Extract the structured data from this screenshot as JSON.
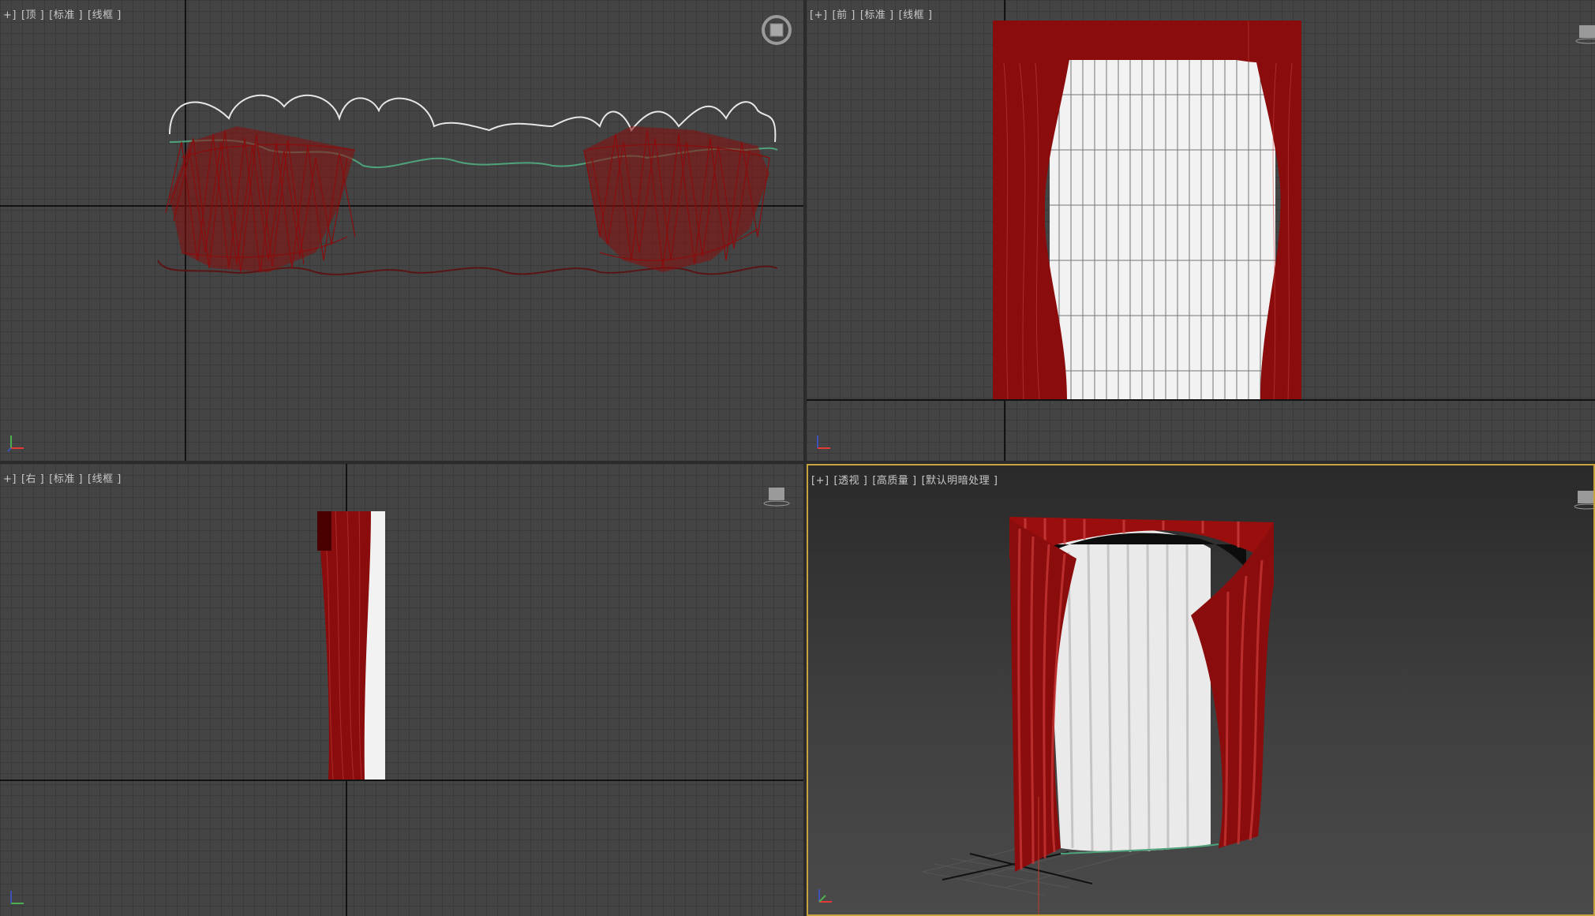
{
  "viewports": {
    "top": {
      "label_plus": "+]",
      "label_view": "[顶 ]",
      "label_shade": "[标准 ]",
      "label_mode": "[线框 ]"
    },
    "front": {
      "label_plus": "[+]",
      "label_view": "[前 ]",
      "label_shade": "[标准 ]",
      "label_mode": "[线框 ]"
    },
    "left": {
      "label_plus": "+]",
      "label_view": "[右 ]",
      "label_shade": "[标准 ]",
      "label_mode": "[线框 ]"
    },
    "persp": {
      "label_plus": "[+]",
      "label_view": "[透视 ]",
      "label_shade": "[高质量 ]",
      "label_mode": "[默认明暗处理 ]"
    }
  },
  "colors": {
    "curtain_red": "#8b0c0c",
    "curtain_white": "#f2f2f2",
    "spline_white": "#e6e6e6",
    "spline_green": "#4fa37a",
    "active_border": "#c8a23c"
  },
  "icons": [
    "view-cube-icon",
    "axis-tripod-icon"
  ]
}
